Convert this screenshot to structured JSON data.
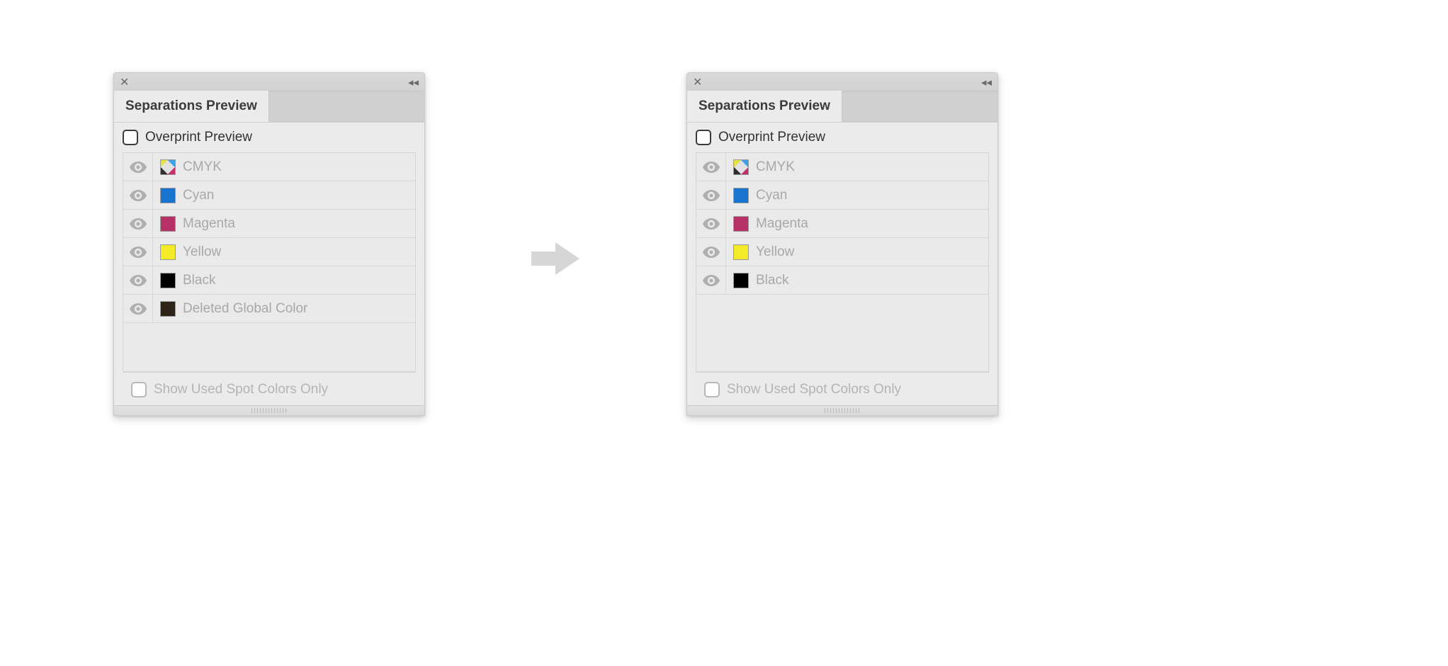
{
  "panels": {
    "left": {
      "tab_label": "Separations Preview",
      "overprint_label": "Overprint Preview",
      "footer_label": "Show Used Spot Colors Only",
      "rows": [
        {
          "label": "CMYK",
          "swatch": "cmyk"
        },
        {
          "label": "Cyan",
          "swatch": "#1974cf"
        },
        {
          "label": "Magenta",
          "swatch": "#b63266"
        },
        {
          "label": "Yellow",
          "swatch": "#f3ea29"
        },
        {
          "label": "Black",
          "swatch": "#000000"
        },
        {
          "label": "Deleted Global Color",
          "swatch": "#2d2316"
        }
      ]
    },
    "right": {
      "tab_label": "Separations Preview",
      "overprint_label": "Overprint Preview",
      "footer_label": "Show Used Spot Colors Only",
      "rows": [
        {
          "label": "CMYK",
          "swatch": "cmyk"
        },
        {
          "label": "Cyan",
          "swatch": "#1974cf"
        },
        {
          "label": "Magenta",
          "swatch": "#b63266"
        },
        {
          "label": "Yellow",
          "swatch": "#f3ea29"
        },
        {
          "label": "Black",
          "swatch": "#000000"
        }
      ]
    }
  }
}
